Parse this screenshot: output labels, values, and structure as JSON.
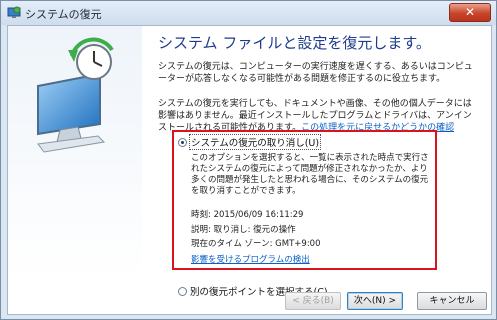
{
  "window": {
    "title": "システムの復元",
    "close_glyph": "✕"
  },
  "page": {
    "heading": "システム ファイルと設定を復元します。",
    "para1": "システムの復元は、コンピューターの実行速度を遅くする、あるいはコンピューターが応答しなくなる可能性がある問題を修正するのに役立ちます。",
    "para2": "システムの復元を実行しても、ドキュメントや画像、その他の個人データには影響はありません。最近インストールしたプログラムとドライバは、アンインストールされる可能性があります。",
    "para2_link": "この処理を元に戻せるかどうかの確認"
  },
  "options": {
    "undo_label": "システムの復元の取り消し(U)",
    "undo_selected": true,
    "undo_description": "このオプションを選択すると、一覧に表示された時点で実行されたシステムの復元によって問題が修正されなかったか、より多くの問題が発生したと思われる場合に、そのシステムの復元を取り消すことができます。",
    "time": "時刻: 2015/06/09 16:11:29",
    "desc": "説明: 取り消し: 復元の操作",
    "timezone": "現在のタイム ゾーン: GMT+9:00",
    "scan_link": "影響を受けるプログラムの検出",
    "other_label": "別の復元ポイントを選択する(C)",
    "other_selected": false
  },
  "buttons": {
    "back": "< 戻る(B)",
    "next": "次へ(N) >",
    "cancel": "キャンセル"
  },
  "colors": {
    "highlight_border": "#d8141e",
    "heading": "#1f3c8c",
    "link": "#0b5fc6"
  }
}
